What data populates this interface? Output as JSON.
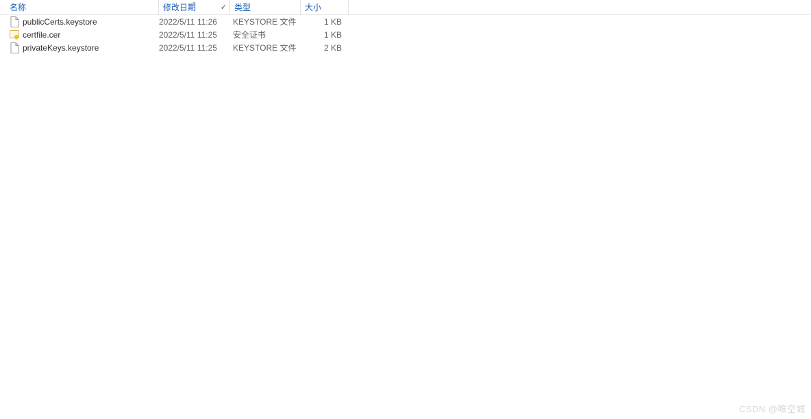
{
  "columns": {
    "name": "名称",
    "date": "修改日期",
    "type": "类型",
    "size": "大小"
  },
  "files": [
    {
      "name": "publicCerts.keystore",
      "date": "2022/5/11 11:26",
      "type": "KEYSTORE 文件",
      "size": "1 KB",
      "icon": "file"
    },
    {
      "name": "certfile.cer",
      "date": "2022/5/11 11:25",
      "type": "安全证书",
      "size": "1 KB",
      "icon": "cert"
    },
    {
      "name": "privateKeys.keystore",
      "date": "2022/5/11 11:25",
      "type": "KEYSTORE 文件",
      "size": "2 KB",
      "icon": "file"
    }
  ],
  "watermark": "CSDN @唯空城"
}
